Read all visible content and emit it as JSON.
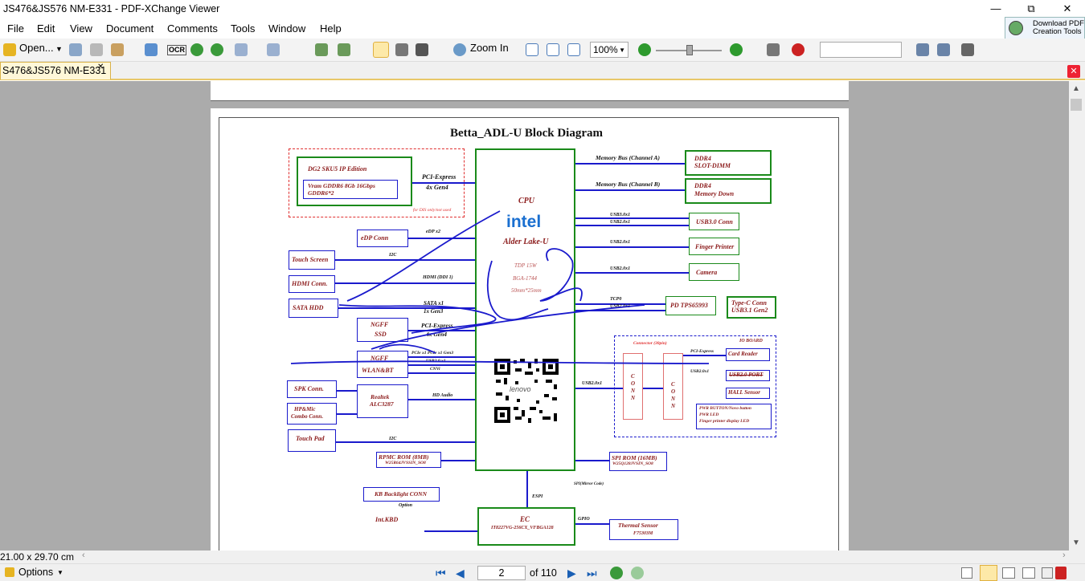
{
  "window": {
    "title": "JS476&JS576 NM-E331 - PDF-XChange Viewer",
    "minimize": "—",
    "maximize": "⧉",
    "close": "✕"
  },
  "menu": [
    "File",
    "Edit",
    "View",
    "Document",
    "Comments",
    "Tools",
    "Window",
    "Help"
  ],
  "download_pdf": {
    "line1": "Download PDF",
    "line2": "Creation Tools"
  },
  "toolbar": {
    "open_label": "Open...",
    "ocr_label": "OCR",
    "zoom_in_label": "Zoom In",
    "zoom_value": "100%",
    "search_value": ""
  },
  "tab": {
    "label": "S476&JS576 NM-E331",
    "close": "✕"
  },
  "doc_close": "✕",
  "status": {
    "page_size": "21.00 x 29.70 cm"
  },
  "bottom": {
    "options_label": "Options",
    "current_page": "2",
    "page_total": "of 110"
  },
  "diagram": {
    "title": "Betta_ADL-U Block Diagram",
    "cpu": {
      "label": "CPU",
      "brand": "intel",
      "model": "Alder Lake-U",
      "tdp": "TDP 15W",
      "package": "BGA-1744",
      "size": "50mm*25mm"
    },
    "dg2": {
      "title": "DG2 SKU5 IP Edition",
      "vram1": "Vram GDDR6 8Gb 16Gbps",
      "vram2": "GDDR6*2",
      "note": "for DIS only/not used"
    },
    "pcie_gpu": {
      "l1": "PCI-Express",
      "l2": "4x Gen4"
    },
    "mem_a": "Memory Bus (Channel A)",
    "mem_b": "Memory Bus (Channel B)",
    "ddr4_slot": {
      "l1": "DDR4",
      "l2": "SLOT-DIMM"
    },
    "ddr4_down": {
      "l1": "DDR4",
      "l2": "Memory Down"
    },
    "usb30_conn": "USB3.0 Conn",
    "usb30_lbl1": "USB3.0x1",
    "usb30_lbl2": "USB2.0x1",
    "finger": "Finger Printer",
    "finger_lbl": "USB2.0x1",
    "camera": "Camera",
    "camera_lbl": "USB2.0x1",
    "pd": "PD TPS65993",
    "tcp_lbl1": "TCP0",
    "tcp_lbl2": "USB2.0x1",
    "typec": {
      "l1": "Type-C Conn",
      "l2": "USB3.1 Gen2"
    },
    "edp": "eDP Conn",
    "edp_lbl": "eDP x2",
    "touch_screen": "Touch Screen",
    "i2c1": "I2C",
    "hdmi": "HDMI Conn.",
    "hdmi_lbl": "HDMI (DDI 1)",
    "sata_hdd": "SATA HDD",
    "sata_lbl1": "SATA x1",
    "sata_lbl2": "1x Gen3",
    "ngff_ssd": {
      "l1": "NGFF",
      "l2": "SSD"
    },
    "ssd_lbl1": "PCI-Express",
    "ssd_lbl2": "4x Gen4",
    "ngff_wlan": {
      "l1": "NGFF",
      "l2": "WLAN&BT"
    },
    "wlan_lbl1": "PCIe x1   PCIe x1 Gen3",
    "wlan_lbl2": "USB2.0 x1",
    "wlan_lbl3": "CNVi",
    "spk": "SPK Conn.",
    "realtek": {
      "l1": "Realtek",
      "l2": "ALC3287"
    },
    "hd_audio": "HD Audio",
    "hpmic": {
      "l1": "HP&Mic",
      "l2": "Combo Conn."
    },
    "touchpad": "Touch Pad",
    "i2c2": "I2C",
    "rpmc": {
      "l1": "RPMC ROM (8MB)",
      "l2": "W25R64JVSSIN_SO8"
    },
    "spi": {
      "l1": "SPI ROM (16MB)",
      "l2": "W25Q128JVSIN_SO8"
    },
    "espi": "ESPI",
    "spi_mirror": "SPI(Mirror Code)",
    "usb_io": "USB2.0x1",
    "io_board": {
      "title": "IO BOARD",
      "connector": "Connector (30pin)",
      "conn": "CONN",
      "pcie": "PCI-Express",
      "card_reader": "Card Reader",
      "usb_lbl": "USB2.0x1",
      "usb_port": "USB2.0 PORT",
      "hall": "HALL Sensor",
      "pwr1": "PWR BUTTON/Novo button",
      "pwr2": "PWR LED",
      "pwr3": "Finger printer display LED"
    },
    "kb_backlight": "KB Backlight CONN",
    "option": "Option",
    "int_kbd": "Int.KBD",
    "ec": {
      "l1": "EC",
      "l2": "IT8227VG-256CX_VFBGA128"
    },
    "gpio": "GPIO",
    "thermal": {
      "l1": "Thermal Sensor",
      "l2": "F75303M"
    },
    "qr_text": "lenovo"
  }
}
